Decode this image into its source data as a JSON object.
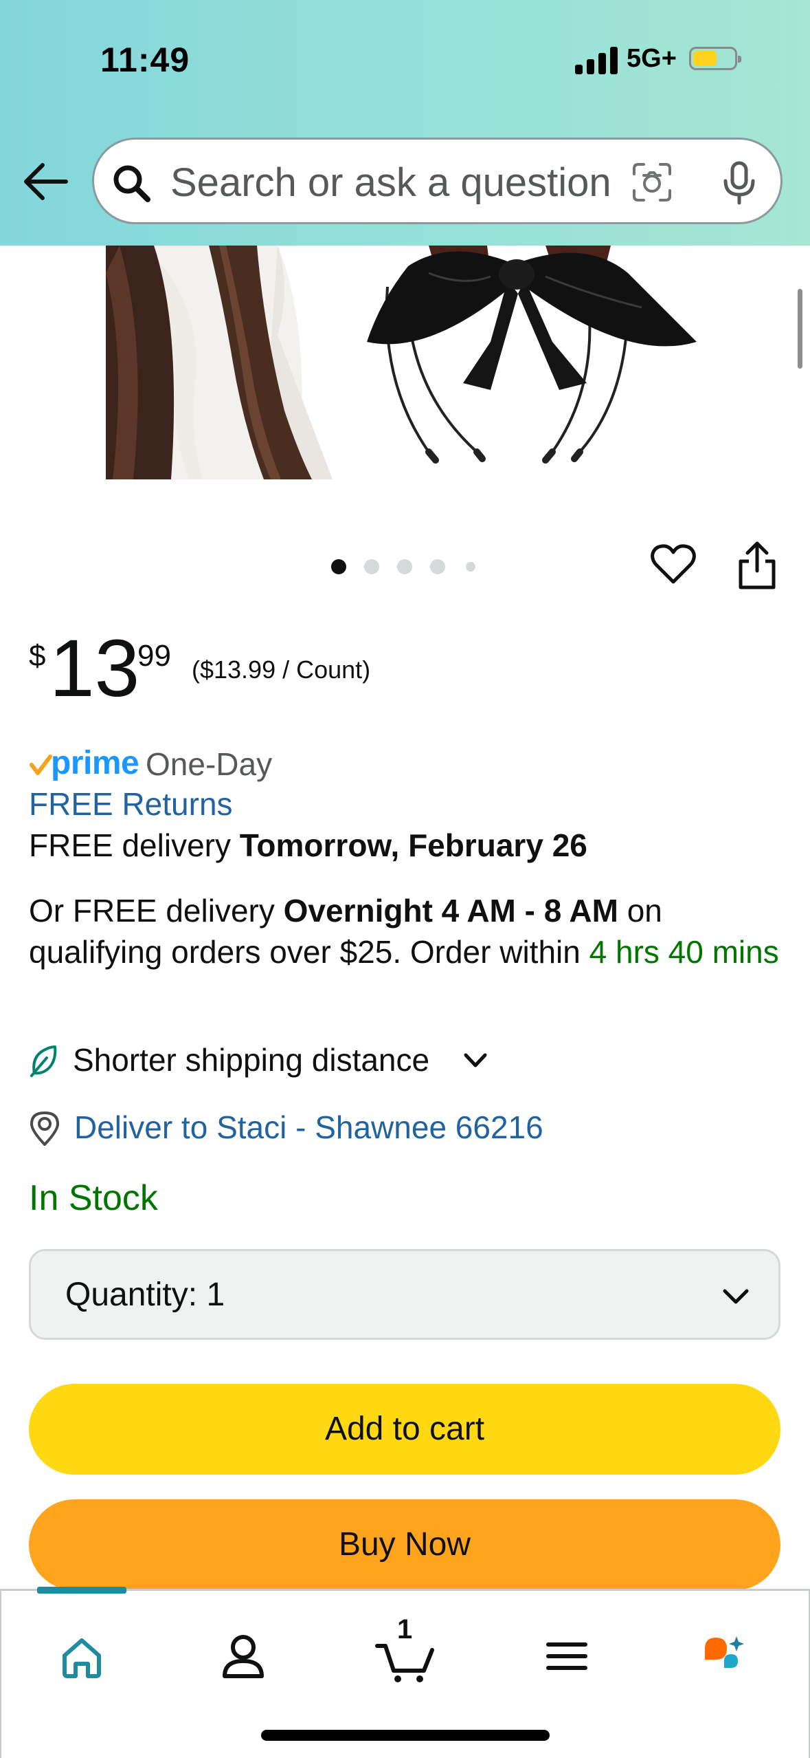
{
  "status_bar": {
    "time": "11:49",
    "network": "5G+"
  },
  "search": {
    "placeholder": "Search or ask a question"
  },
  "product": {
    "carousel": {
      "count": 5,
      "active_index": 0
    }
  },
  "price": {
    "symbol": "$",
    "whole": "13",
    "fraction": "99",
    "per_unit": "($13.99 / Count)"
  },
  "delivery": {
    "prime_label": "prime",
    "prime_speed": "One-Day",
    "free_returns": "FREE Returns",
    "free_delivery_prefix": "FREE delivery",
    "free_delivery_date": "Tomorrow, February 26",
    "overnight_prefix": "Or FREE delivery",
    "overnight_window": "Overnight 4 AM - 8 AM",
    "overnight_suffix": "on qualifying orders over $25. Order within",
    "countdown": "4 hrs 40 mins",
    "shorter_shipping": "Shorter shipping distance",
    "deliver_to": "Deliver to Staci - Shawnee 66216"
  },
  "stock": {
    "status": "In Stock"
  },
  "quantity": {
    "label": "Quantity:",
    "value": "1"
  },
  "actions": {
    "add_to_cart": "Add to cart",
    "buy_now": "Buy Now"
  },
  "bottom_nav": {
    "cart_count": "1",
    "active_tab": "home"
  },
  "colors": {
    "header_gradient": [
      "#83d6dc",
      "#a6e6d3"
    ],
    "link": "#2162a1",
    "green": "#007600",
    "prime_blue": "#1a98ff",
    "add_to_cart": "#ffd814",
    "buy_now": "#ffa41c",
    "nav_active": "#1f8aa0"
  },
  "icons": [
    "back-arrow-icon",
    "search-icon",
    "camera-lens-icon",
    "microphone-icon",
    "heart-icon",
    "share-icon",
    "prime-check-icon",
    "leaf-icon",
    "location-pin-icon",
    "chevron-down-icon",
    "home-icon",
    "account-icon",
    "cart-icon",
    "menu-icon",
    "rufus-icon"
  ]
}
